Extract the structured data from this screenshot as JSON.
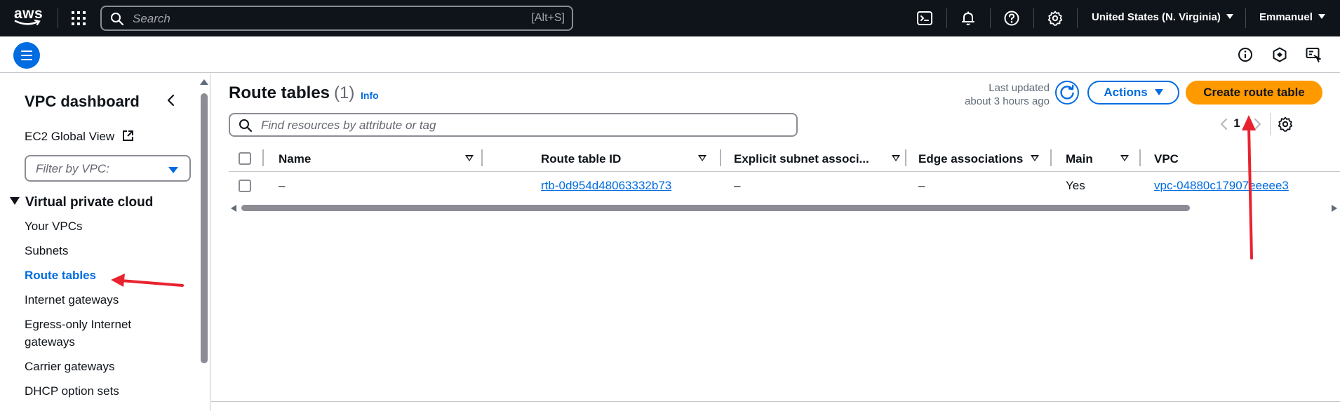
{
  "topnav": {
    "logo": "aws",
    "search_placeholder": "Search",
    "search_shortcut": "[Alt+S]",
    "icons": [
      "cloudshell-icon",
      "bell-icon",
      "help-icon",
      "settings-icon"
    ],
    "region": "United States (N. Virginia)",
    "user": "Emmanuel"
  },
  "subbar": {
    "icons": [
      "info-icon",
      "notifications-icon",
      "feedback-icon"
    ]
  },
  "sidebar": {
    "title": "VPC dashboard",
    "global_view": "EC2 Global View",
    "filter_placeholder": "Filter by VPC:",
    "section": "Virtual private cloud",
    "items": [
      {
        "label": "Your VPCs"
      },
      {
        "label": "Subnets"
      },
      {
        "label": "Route tables",
        "active": true
      },
      {
        "label": "Internet gateways"
      },
      {
        "label": "Egress-only Internet gateways"
      },
      {
        "label": "Carrier gateways"
      },
      {
        "label": "DHCP option sets"
      }
    ]
  },
  "main": {
    "title": "Route tables",
    "count": "(1)",
    "info": "Info",
    "last_updated_label": "Last updated",
    "last_updated_value": "about 3 hours ago",
    "actions_label": "Actions",
    "create_label": "Create route table",
    "filter_placeholder": "Find resources by attribute or tag",
    "page": "1"
  },
  "table": {
    "columns": [
      "Name",
      "Route table ID",
      "Explicit subnet associ...",
      "Edge associations",
      "Main",
      "VPC"
    ],
    "rows": [
      {
        "name": "–",
        "route_table_id": "rtb-0d954d48063332b73",
        "explicit_subnet": "–",
        "edge_associations": "–",
        "main": "Yes",
        "vpc": "vpc-04880c17907eeeee3"
      }
    ]
  },
  "colors": {
    "nav_bg": "#0f141a",
    "accent": "#006ce0",
    "primary_button": "#ff9900",
    "annotation_arrow": "#e8232f"
  }
}
